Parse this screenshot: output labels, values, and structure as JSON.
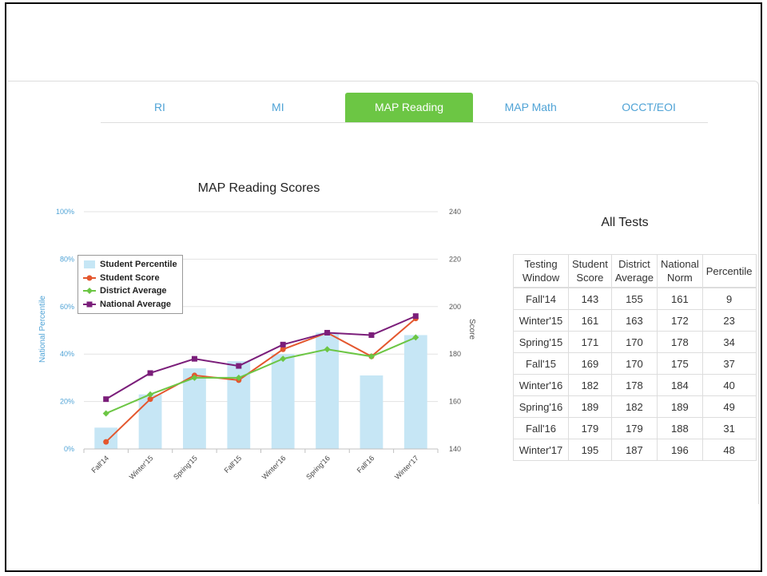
{
  "tabs": [
    {
      "label": "RI",
      "active": false
    },
    {
      "label": "MI",
      "active": false
    },
    {
      "label": "MAP Reading",
      "active": true
    },
    {
      "label": "MAP Math",
      "active": false
    },
    {
      "label": "OCCT/EOI",
      "active": false
    }
  ],
  "colors": {
    "accent_green": "#6cc644",
    "tab_text": "#4fa3d6",
    "bar": "#c6e6f5",
    "student_score": "#e4572e",
    "district_average": "#6cc644",
    "national_average": "#7b1e7a"
  },
  "chart_data": {
    "type": "bar+line",
    "title": "MAP Reading Scores",
    "ylabel_left": "National Percentile",
    "ylabel_right": "Score",
    "categories": [
      "Fall'14",
      "Winter'15",
      "Spring'15",
      "Fall'15",
      "Winter'16",
      "Spring'16",
      "Fall'16",
      "Winter'17"
    ],
    "left_axis": {
      "ticks": [
        "0%",
        "20%",
        "40%",
        "60%",
        "80%",
        "100%"
      ],
      "range": [
        0,
        100
      ]
    },
    "right_axis": {
      "ticks": [
        "140",
        "160",
        "180",
        "200",
        "220",
        "240"
      ],
      "range": [
        140,
        240
      ]
    },
    "grid": true,
    "legend_position": "top-left",
    "bars": {
      "name": "Student Percentile",
      "axis": "left",
      "values": [
        9,
        23,
        34,
        37,
        40,
        49,
        31,
        48
      ]
    },
    "series": [
      {
        "name": "Student Score",
        "axis": "right",
        "values": [
          143,
          161,
          171,
          169,
          182,
          189,
          179,
          195
        ]
      },
      {
        "name": "District Average",
        "axis": "right",
        "values": [
          155,
          163,
          170,
          170,
          178,
          182,
          179,
          187
        ]
      },
      {
        "name": "National Average",
        "axis": "right",
        "values": [
          161,
          172,
          178,
          175,
          184,
          189,
          188,
          196
        ]
      }
    ]
  },
  "table": {
    "title": "All Tests",
    "headers": [
      [
        "Testing",
        "Window"
      ],
      [
        "Student",
        "Score"
      ],
      [
        "District",
        "Average"
      ],
      [
        "National",
        "Norm"
      ],
      [
        "Percentile",
        ""
      ]
    ],
    "rows": [
      [
        "Fall'14",
        "143",
        "155",
        "161",
        "9"
      ],
      [
        "Winter'15",
        "161",
        "163",
        "172",
        "23"
      ],
      [
        "Spring'15",
        "171",
        "170",
        "178",
        "34"
      ],
      [
        "Fall'15",
        "169",
        "170",
        "175",
        "37"
      ],
      [
        "Winter'16",
        "182",
        "178",
        "184",
        "40"
      ],
      [
        "Spring'16",
        "189",
        "182",
        "189",
        "49"
      ],
      [
        "Fall'16",
        "179",
        "179",
        "188",
        "31"
      ],
      [
        "Winter'17",
        "195",
        "187",
        "196",
        "48"
      ]
    ]
  }
}
